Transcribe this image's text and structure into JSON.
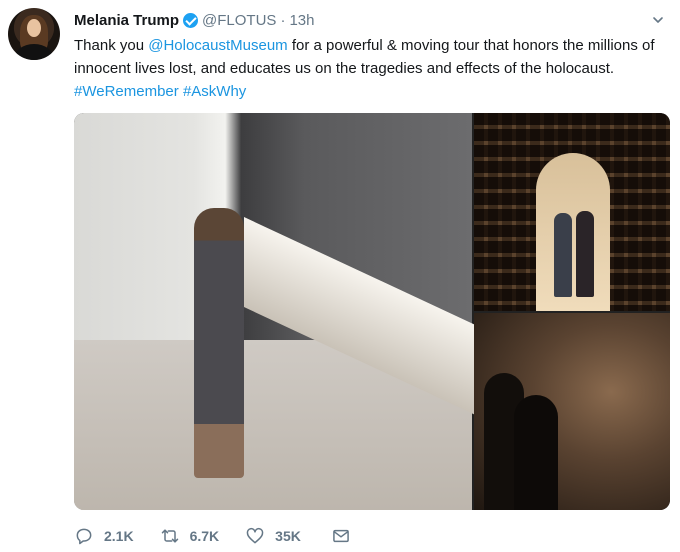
{
  "tweet": {
    "author": {
      "display_name": "Melania Trump",
      "handle": "@FLOTUS",
      "separator": "·",
      "timestamp": "13h",
      "verified": true
    },
    "text": {
      "part1": "Thank you ",
      "mention": "@HolocaustMuseum",
      "part2": " for a powerful & moving tour that honors the millions of innocent lives lost, and educates us on the tragedies and effects of the holocaust. ",
      "hashtag1": "#WeRemember",
      "space": " ",
      "hashtag2": "#AskWhy"
    },
    "actions": {
      "reply_count": "2.1K",
      "retweet_count": "6.7K",
      "like_count": "35K"
    }
  },
  "colors": {
    "link": "#1b95e0",
    "verified": "#1da1f2",
    "muted": "#657786",
    "text": "#14171a"
  },
  "icons": [
    "verified-badge-icon",
    "chevron-down-icon",
    "reply-icon",
    "retweet-icon",
    "like-icon",
    "direct-message-icon"
  ]
}
